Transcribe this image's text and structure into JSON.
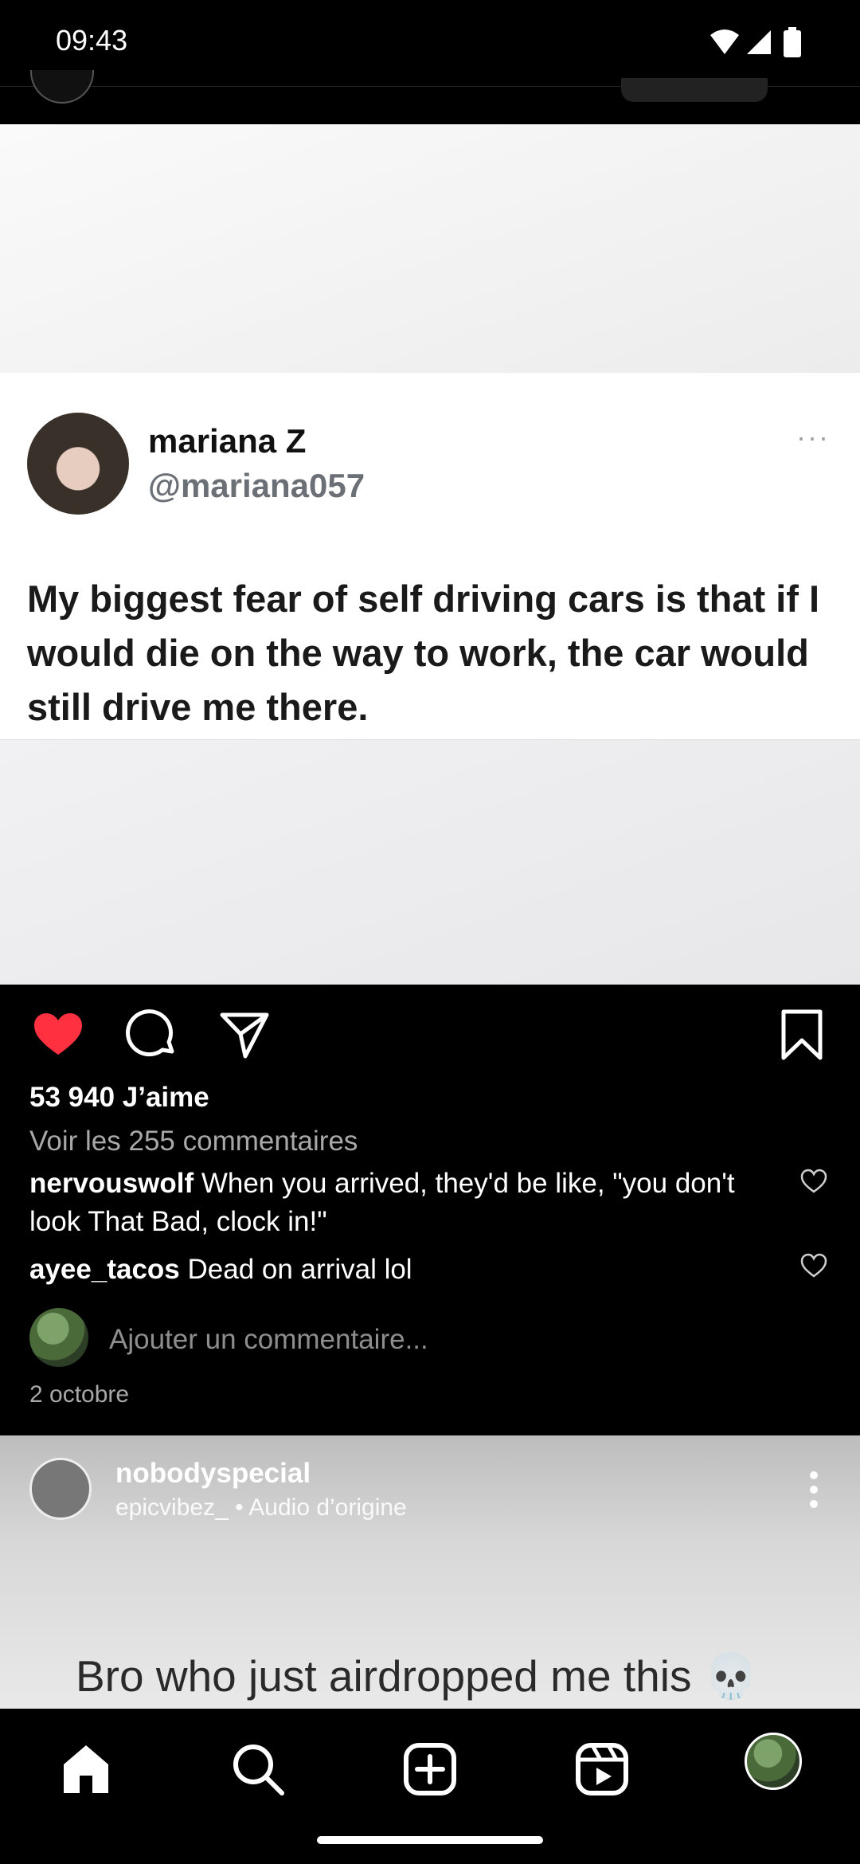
{
  "status_bar": {
    "time": "09:43"
  },
  "tweet": {
    "name": "mariana Z",
    "handle": "@mariana057",
    "more": "···",
    "text": "My biggest fear of self driving cars is that if I would die on the way to work, the car would still drive me there."
  },
  "post": {
    "likes": "53 940 J’aime",
    "view_comments": "Voir les 255 commentaires",
    "comments": [
      {
        "user": "nervouswolf",
        "text": "When you arrived, they'd be like, \"you don't look That Bad, clock in!\""
      },
      {
        "user": "ayee_tacos",
        "text": "Dead on arrival lol"
      }
    ],
    "add_comment_placeholder": "Ajouter un commentaire...",
    "date": "2 octobre"
  },
  "next_post": {
    "username": "nobodyspecial",
    "audio": "epicvibez_ • Audio d’origine",
    "caption": "Bro who just airdropped me this 💀"
  },
  "icons": {
    "like": "heart-filled-icon",
    "comment": "comment-icon",
    "share": "send-icon",
    "save": "bookmark-icon",
    "nav": [
      "home-icon",
      "search-icon",
      "create-icon",
      "reels-icon",
      "profile-avatar"
    ]
  },
  "colors": {
    "like_red": "#ff3040",
    "background": "#000000"
  }
}
